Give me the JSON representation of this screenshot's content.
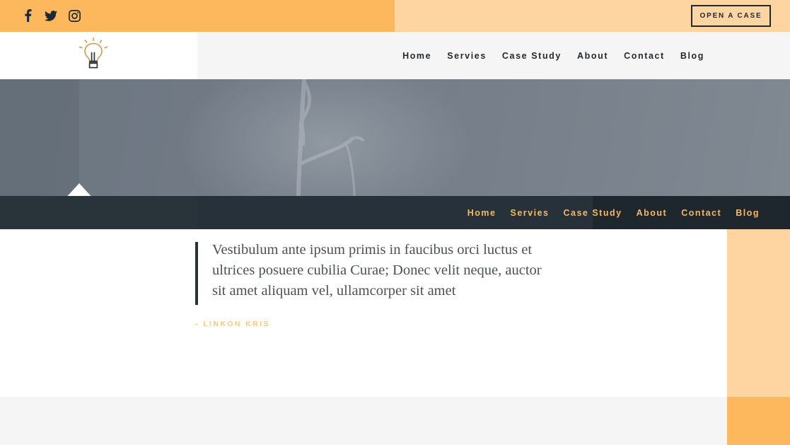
{
  "topbar": {
    "social": [
      {
        "name": "facebook-icon",
        "label": "Facebook"
      },
      {
        "name": "twitter-icon",
        "label": "Twitter"
      },
      {
        "name": "instagram-icon",
        "label": "Instagram"
      }
    ],
    "cta_label": "OPEN A CASE",
    "left_bg": "#fdb85e",
    "right_bg": "#fed4a0"
  },
  "header": {
    "logo_name": "lightbulb-logo",
    "nav": [
      {
        "label": "Home"
      },
      {
        "label": "Servies"
      },
      {
        "label": "Case Study"
      },
      {
        "label": "About"
      },
      {
        "label": "Contact"
      },
      {
        "label": "Blog"
      }
    ]
  },
  "hero": {
    "cursor_icon": "vertical-resize-arrow-icon",
    "overlay_color": "#737c87"
  },
  "darknav": {
    "bg": "#273139",
    "accent": "#f3b96a",
    "nav": [
      {
        "label": "Home"
      },
      {
        "label": "Servies"
      },
      {
        "label": "Case Study"
      },
      {
        "label": "About"
      },
      {
        "label": "Contact"
      },
      {
        "label": "Blog"
      }
    ]
  },
  "quote": {
    "text": "Vestibulum ante ipsum primis in faucibus orci luctus et ultrices posuere cubilia Curae; Donec velit neque, auctor sit amet aliquam vel, ullamcorper sit amet",
    "author": "- LINKON KRIS",
    "accent": "#fcc77f"
  },
  "panels": {
    "right_top_bg": "#fed4a0",
    "right_bottom_bg": "#fdb85e",
    "bottom_bg": "#f5f5f5"
  }
}
